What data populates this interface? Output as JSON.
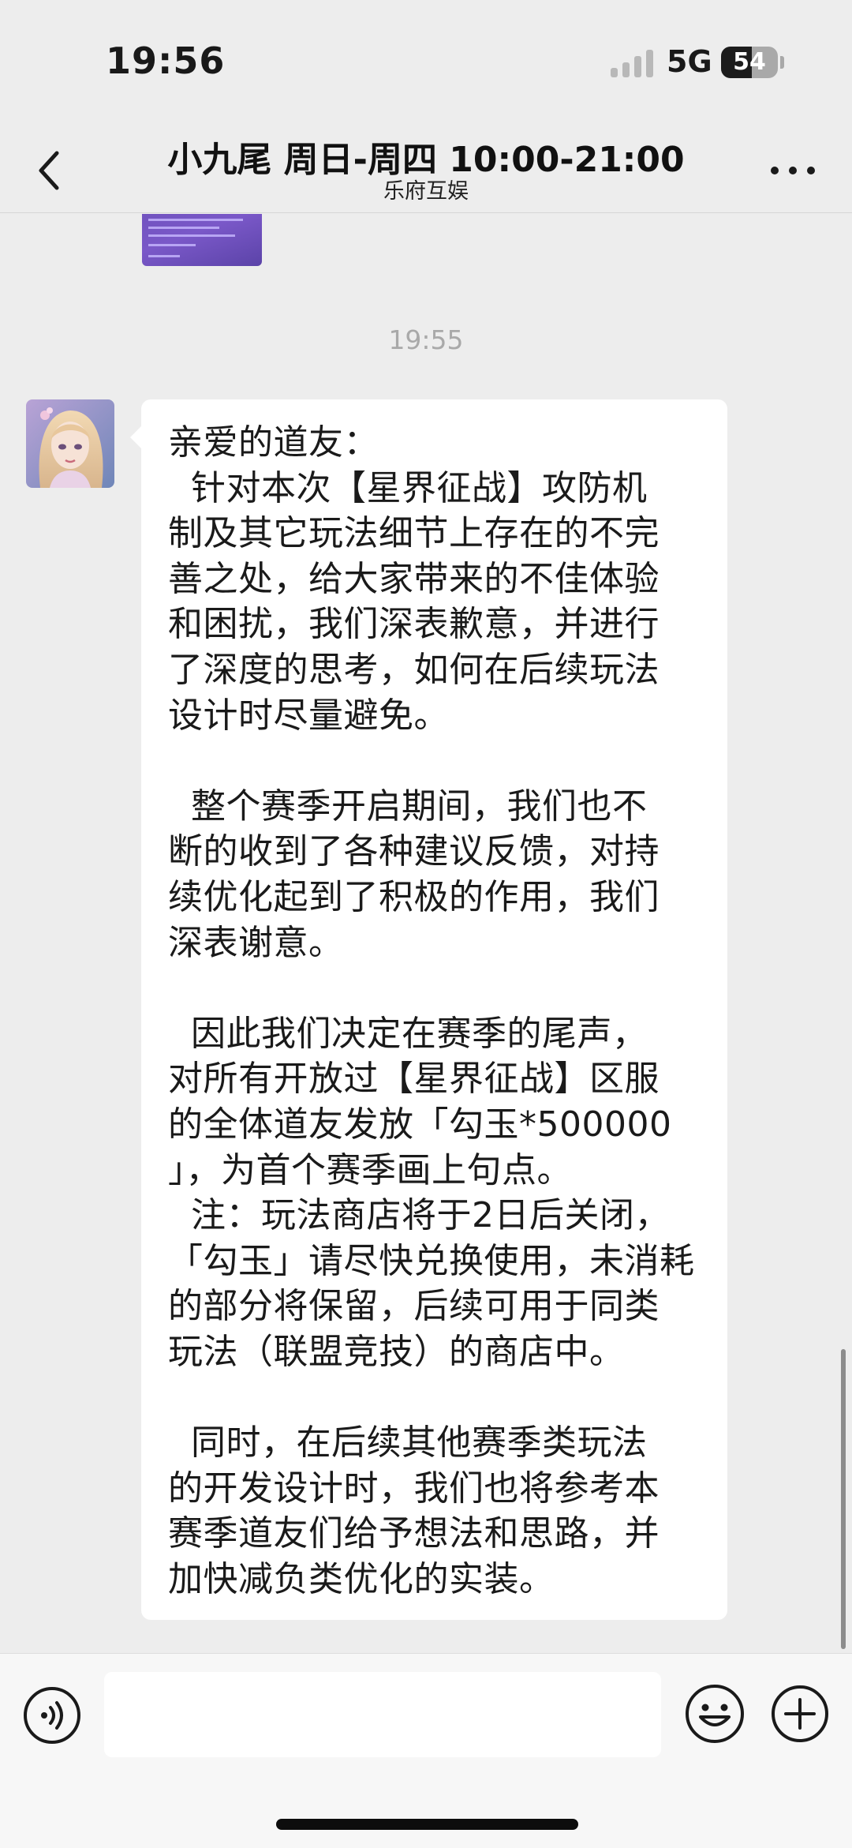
{
  "status_bar": {
    "time": "19:56",
    "network": "5G",
    "battery_level": "54",
    "battery_fraction": 0.54
  },
  "nav": {
    "title": "小九尾 周日-周四 10:00-21:00",
    "subtitle": "乐府互娱"
  },
  "chat": {
    "timestamp": "19:55",
    "message_lines": [
      "亲爱的道友：",
      "  针对本次【星界征战】攻防机",
      "制及其它玩法细节上存在的不完",
      "善之处，给大家带来的不佳体验",
      "和困扰，我们深表歉意，并进行",
      "了深度的思考，如何在后续玩法",
      "设计时尽量避免。",
      "",
      "  整个赛季开启期间，我们也不",
      "断的收到了各种建议反馈，对持",
      "续优化起到了积极的作用，我们",
      "深表谢意。",
      "",
      "  因此我们决定在赛季的尾声，",
      "对所有开放过【星界征战】区服",
      "的全体道友发放「勾玉*500000",
      "」，为首个赛季画上句点。",
      "  注：玩法商店将于2日后关闭，",
      "「勾玉」请尽快兑换使用，未消耗",
      "的部分将保留，后续可用于同类",
      "玩法（联盟竞技）的商店中。",
      "",
      "  同时，在后续其他赛季类玩法",
      "的开发设计时，我们也将参考本",
      "赛季道友们给予想法和思路，并",
      "加快减负类优化的实装。"
    ]
  },
  "input_bar": {
    "placeholder": ""
  },
  "icons": {
    "back": "chevron-left-icon",
    "more": "more-dots-icon",
    "voice": "voice-icon",
    "emoji": "emoji-icon",
    "plus": "plus-icon"
  },
  "colors": {
    "background": "#ededed",
    "bubble": "#ffffff",
    "timestamp": "#a9a9a9",
    "input_bar": "#f7f7f7"
  }
}
